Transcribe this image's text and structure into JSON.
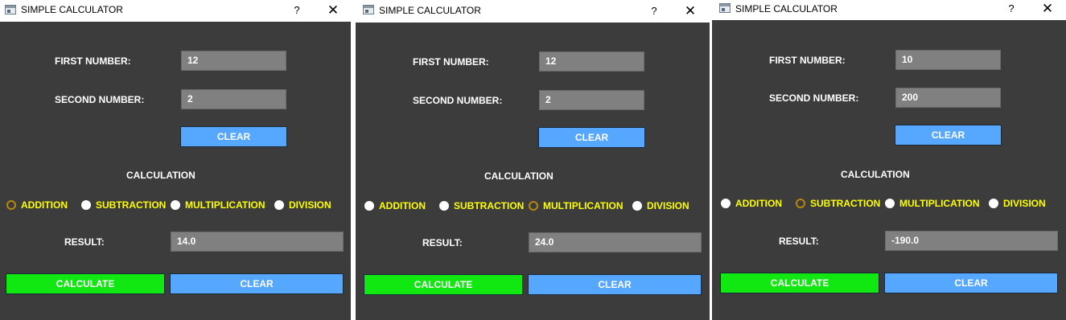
{
  "windows": [
    {
      "title": "SIMPLE CALCULATOR",
      "help_label": "?",
      "close_label": "✕",
      "first_label": "FIRST NUMBER:",
      "first_value": "12",
      "second_label": "SECOND NUMBER:",
      "second_value": "2",
      "clear_top_label": "CLEAR",
      "calc_heading": "CALCULATION",
      "ops": [
        {
          "label": "ADDITION",
          "selected": true
        },
        {
          "label": "SUBTRACTION",
          "selected": false
        },
        {
          "label": "MULTIPLICATION",
          "selected": false
        },
        {
          "label": "DIVISION",
          "selected": false
        }
      ],
      "result_label": "RESULT:",
      "result_value": "14.0",
      "calculate_label": "CALCULATE",
      "clear_bottom_label": "CLEAR"
    },
    {
      "title": "SIMPLE CALCULATOR",
      "help_label": "?",
      "close_label": "✕",
      "first_label": "FIRST NUMBER:",
      "first_value": "12",
      "second_label": "SECOND NUMBER:",
      "second_value": "2",
      "clear_top_label": "CLEAR",
      "calc_heading": "CALCULATION",
      "ops": [
        {
          "label": "ADDITION",
          "selected": false
        },
        {
          "label": "SUBTRACTION",
          "selected": false
        },
        {
          "label": "MULTIPLICATION",
          "selected": true
        },
        {
          "label": "DIVISION",
          "selected": false
        }
      ],
      "result_label": "RESULT:",
      "result_value": "24.0",
      "calculate_label": "CALCULATE",
      "clear_bottom_label": "CLEAR"
    },
    {
      "title": "SIMPLE CALCULATOR",
      "help_label": "?",
      "close_label": "✕",
      "first_label": "FIRST NUMBER:",
      "first_value": "10",
      "second_label": "SECOND NUMBER:",
      "second_value": "200",
      "clear_top_label": "CLEAR",
      "calc_heading": "CALCULATION",
      "ops": [
        {
          "label": "ADDITION",
          "selected": false
        },
        {
          "label": "SUBTRACTION",
          "selected": true
        },
        {
          "label": "MULTIPLICATION",
          "selected": false
        },
        {
          "label": "DIVISION",
          "selected": false
        }
      ],
      "result_label": "RESULT:",
      "result_value": "-190.0",
      "calculate_label": "CALCULATE",
      "clear_bottom_label": "CLEAR"
    }
  ],
  "colors": {
    "panel_bg": "#3c3c3c",
    "field_bg": "#808080",
    "calculate_bg": "#11e811",
    "clear_bg": "#55a7ff",
    "radio_label": "#ffff00"
  }
}
